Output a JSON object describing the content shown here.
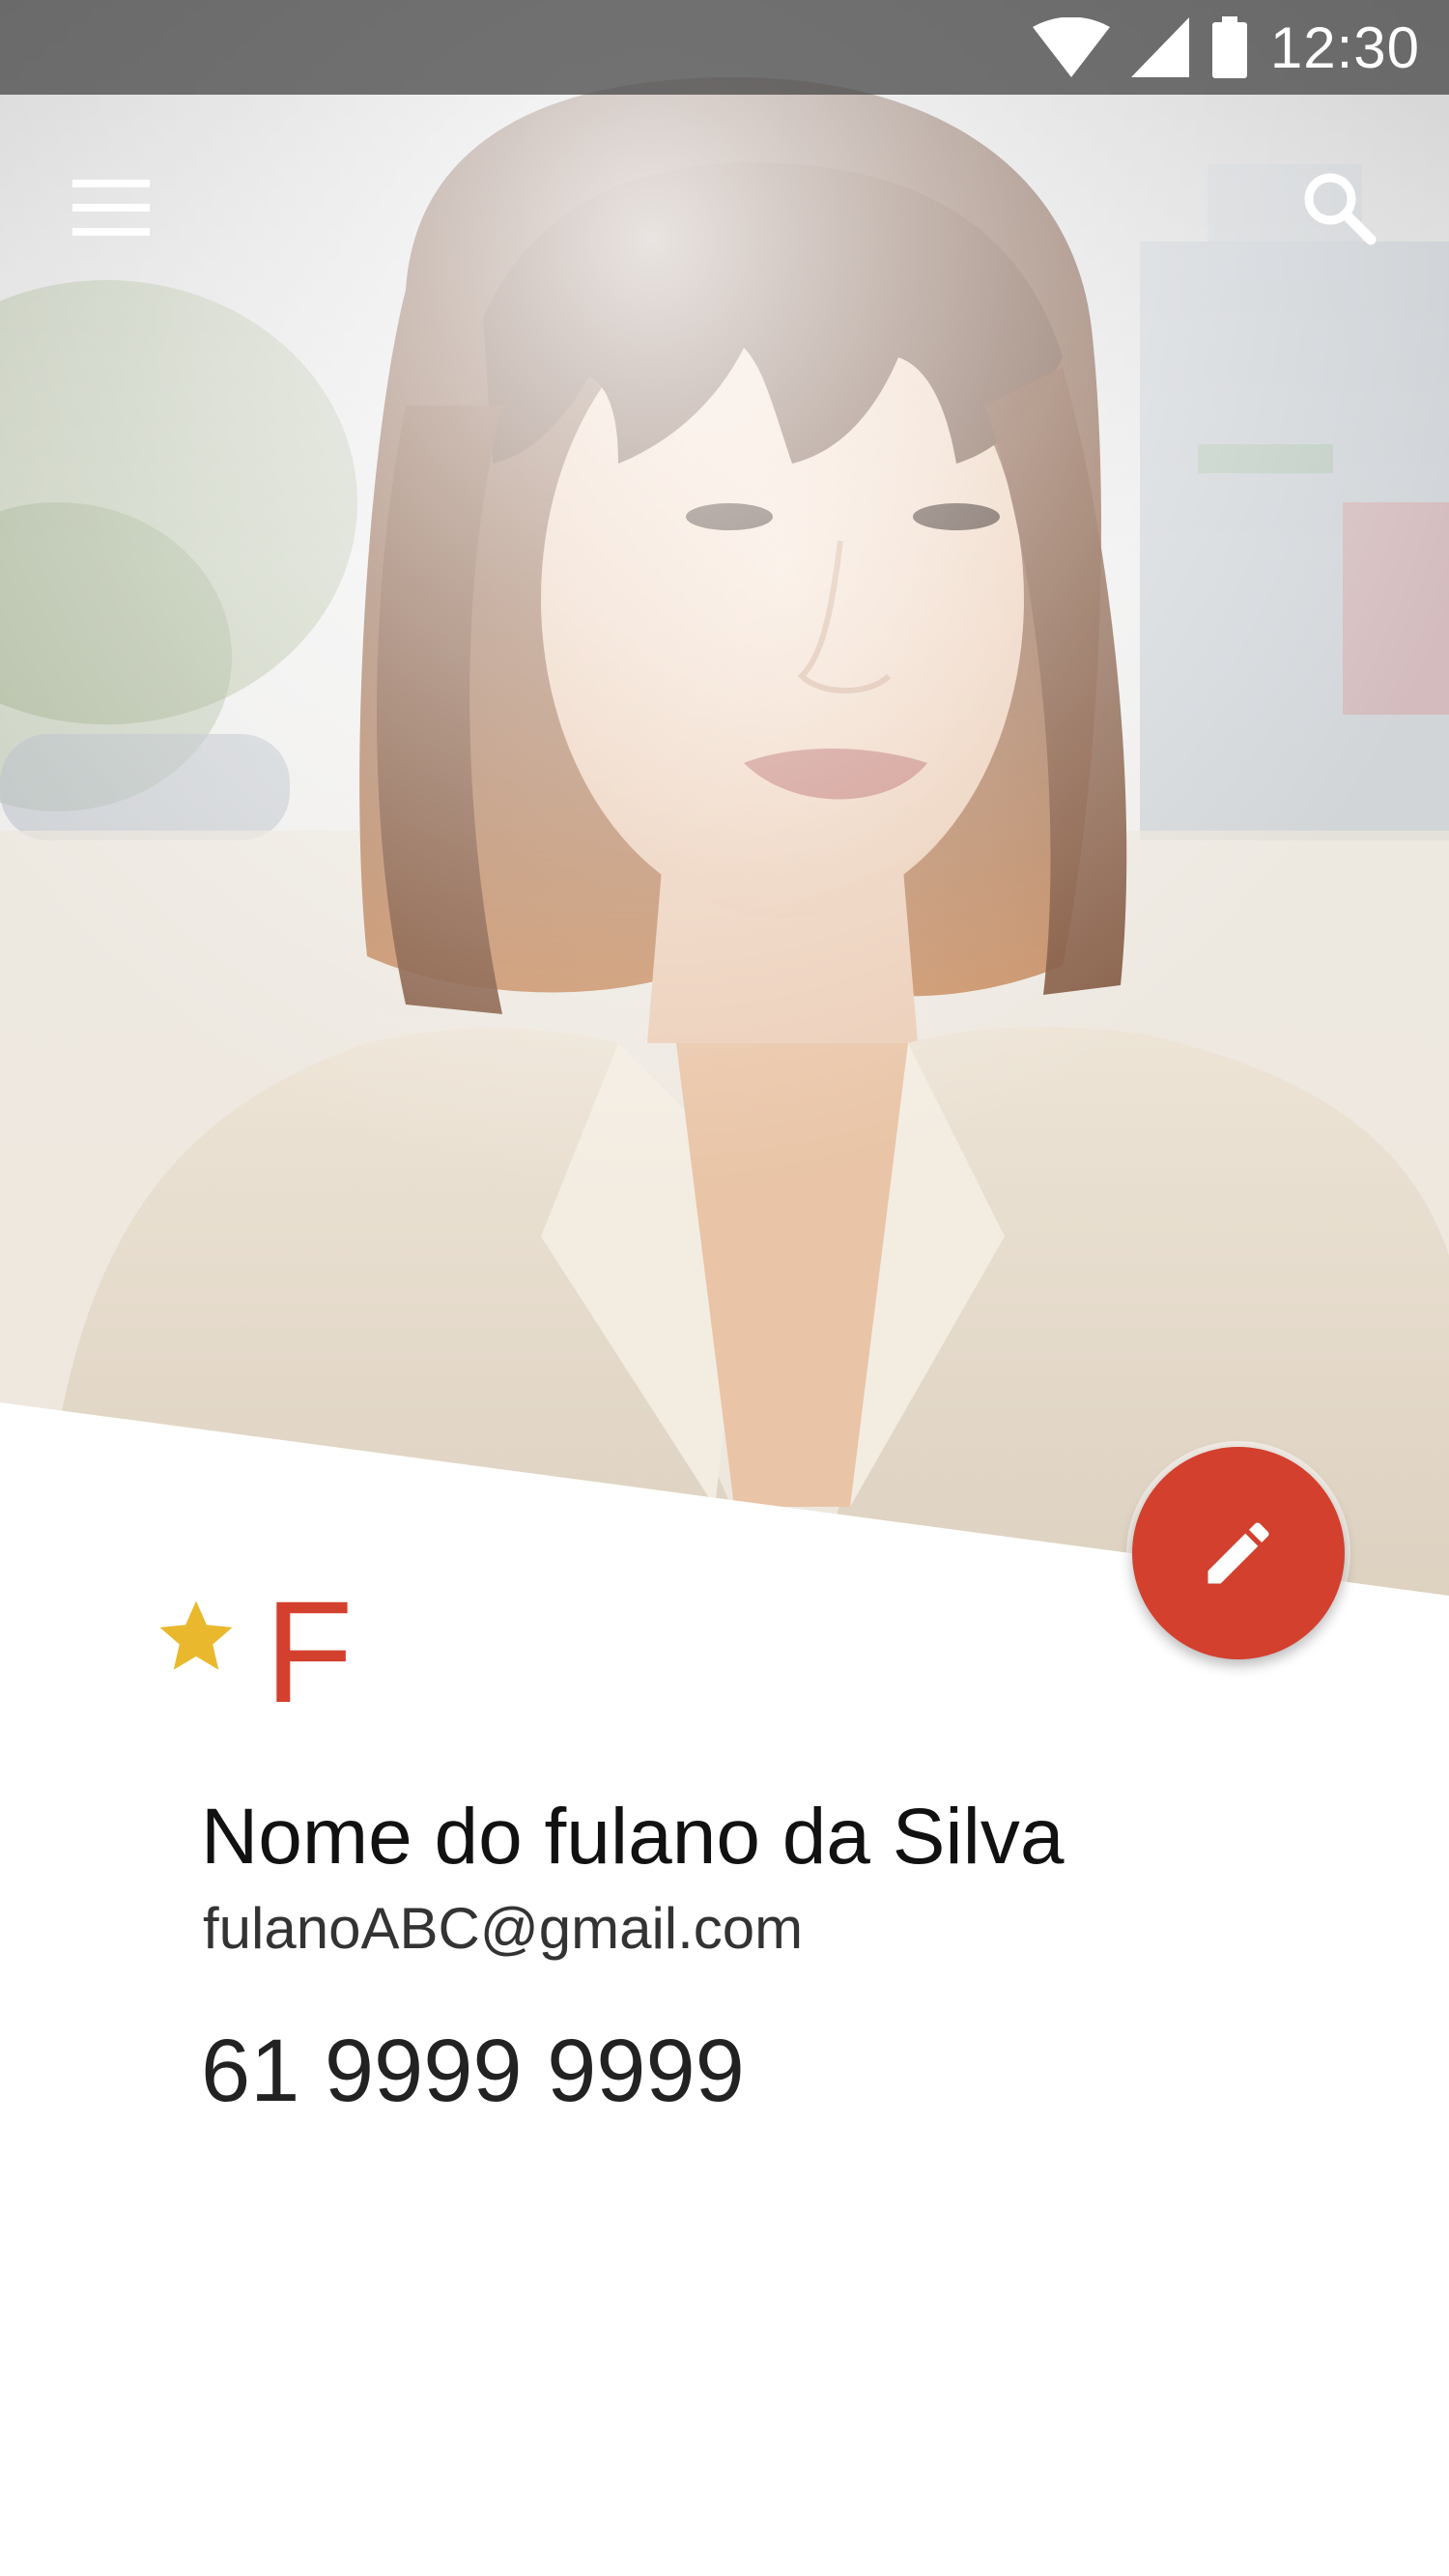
{
  "status_bar": {
    "time": "12:30",
    "icons": [
      "wifi-icon",
      "cellular-signal-icon",
      "battery-icon"
    ]
  },
  "app_bar": {
    "menu_icon": "hamburger-menu-icon",
    "search_icon": "search-icon"
  },
  "contact": {
    "favorite": true,
    "initial": "F",
    "name": "Nome do fulano da Silva",
    "email": "fulanoABC@gmail.com",
    "phone": "61 9999 9999"
  },
  "fab": {
    "icon": "edit-pencil-icon"
  },
  "colors": {
    "accent": "#d3402e",
    "star": "#e9b82c",
    "status_bar": "#464646"
  }
}
